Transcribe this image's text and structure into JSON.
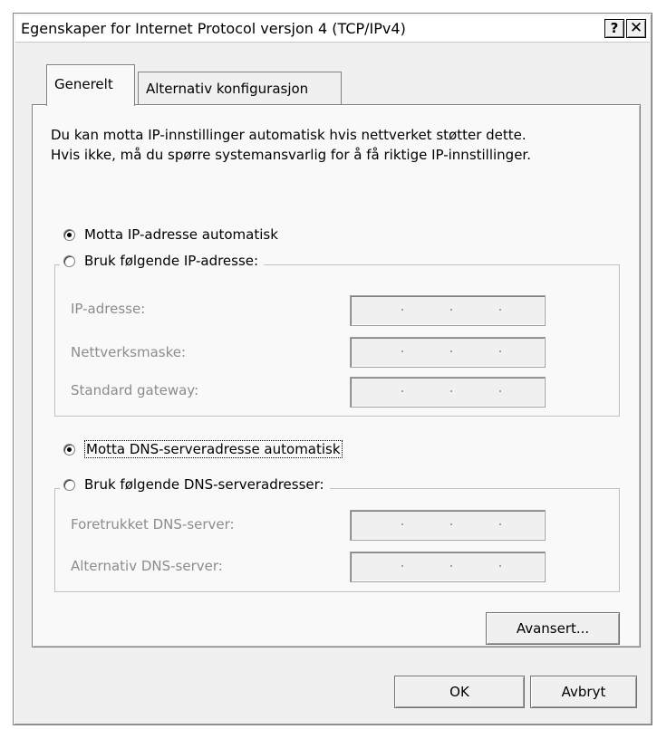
{
  "window": {
    "title": "Egenskaper for Internet Protocol versjon 4 (TCP/IPv4)",
    "help_button": "?",
    "close_button": "✕"
  },
  "tabs": [
    {
      "label": "Generelt",
      "active": true
    },
    {
      "label": "Alternativ konfigurasjon",
      "active": false
    }
  ],
  "intro": {
    "line1": "Du kan motta IP-innstillinger automatisk hvis nettverket støtter dette.",
    "line2": "Hvis ikke, må du spørre systemansvarlig for å få riktige IP-innstillinger."
  },
  "ip": {
    "auto_label": "Motta IP-adresse automatisk",
    "auto_checked": true,
    "manual_label": "Bruk følgende IP-adresse:",
    "manual_checked": false,
    "fields": {
      "ip_address": "IP-adresse:",
      "subnet_mask": "Nettverksmaske:",
      "default_gateway": "Standard gateway:"
    }
  },
  "dns": {
    "auto_label": "Motta DNS-serveradresse automatisk",
    "auto_checked": true,
    "manual_label": "Bruk følgende DNS-serveradresser:",
    "manual_checked": false,
    "fields": {
      "preferred": "Foretrukket DNS-server:",
      "alternate": "Alternativ DNS-server:"
    }
  },
  "buttons": {
    "advanced": "Avansert...",
    "ok": "OK",
    "cancel": "Avbryt"
  }
}
